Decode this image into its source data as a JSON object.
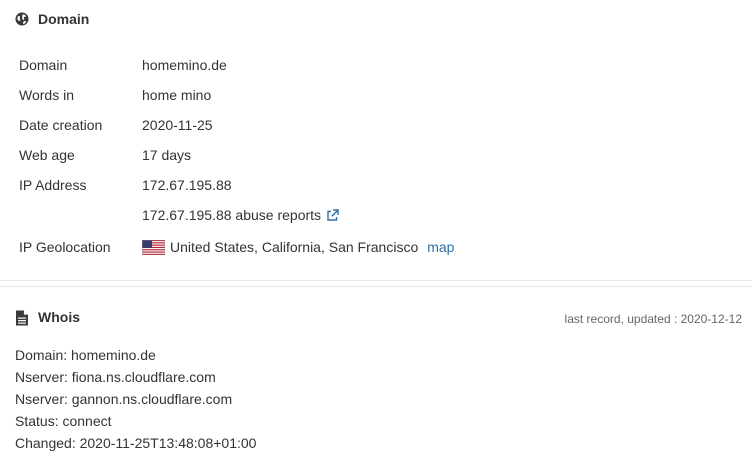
{
  "domain_section": {
    "title": "Domain",
    "icon": "globe-icon",
    "rows": {
      "domain": {
        "label": "Domain",
        "value": "homemino.de"
      },
      "words": {
        "label": "Words in",
        "value": "home mino"
      },
      "creation": {
        "label": "Date creation",
        "value": "2020-11-25"
      },
      "webage": {
        "label": "Web age",
        "value": "17 days"
      },
      "ip": {
        "label": "IP Address",
        "value": "172.67.195.88"
      },
      "abuse": {
        "value": "172.67.195.88 abuse reports"
      },
      "geo": {
        "label": "IP Geolocation",
        "value": "United States, California, San Francisco",
        "map_link": "map",
        "flag": "us-flag-icon"
      }
    }
  },
  "whois_section": {
    "title": "Whois",
    "icon": "document-icon",
    "updated": "last record, updated : 2020-12-12",
    "lines": [
      "Domain: homemino.de",
      "Nserver: fiona.ns.cloudflare.com",
      "Nserver: gannon.ns.cloudflare.com",
      "Status: connect",
      "Changed: 2020-11-25T13:48:08+01:00"
    ]
  },
  "colors": {
    "text": "#333333",
    "link": "#2f6fa7",
    "muted": "#666666",
    "divider": "#e6e6e6"
  }
}
